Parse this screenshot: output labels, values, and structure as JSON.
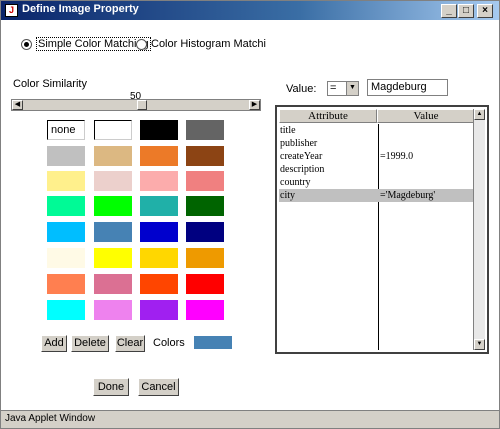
{
  "window": {
    "title": "Define Image Property",
    "controls": {
      "minimize": "_",
      "maximize": "□",
      "close": "×"
    }
  },
  "matching": {
    "options": [
      {
        "label": "Simple Color Matching",
        "selected": true
      },
      {
        "label": "Color Histogram Matchi",
        "selected": false
      }
    ]
  },
  "similarity": {
    "label": "Color Similarity",
    "value": "50"
  },
  "palette": {
    "first_swatch_text": "none",
    "swatches": [
      "none-box",
      "white-box",
      "#000000",
      "#646464",
      "#c0c0c0",
      "#dcb882",
      "#ec7a28",
      "#8c4414",
      "#fff08c",
      "#ecd0cc",
      "#fcacac",
      "#f08080",
      "#00fa96",
      "#00ff00",
      "#20b0a8",
      "#006400",
      "#00beff",
      "#4682b4",
      "#0000cd",
      "#000080",
      "#fffae6",
      "#ffff00",
      "#ffd700",
      "#ee9a00",
      "#ff7f50",
      "#db7093",
      "#ff4500",
      "#ff0000",
      "#00ffff",
      "#ee82ee",
      "#a020f0",
      "#ff00ff"
    ],
    "selected_color": "#4682b4"
  },
  "palette_buttons": {
    "add": "Add",
    "delete": "Delete",
    "clear": "Clear",
    "colors_label": "Colors"
  },
  "dialog_buttons": {
    "done": "Done",
    "cancel": "Cancel"
  },
  "value_filter": {
    "label": "Value:",
    "operator": "=",
    "text": "Magdeburg"
  },
  "attributes_table": {
    "headers": [
      "Attribute",
      "Value"
    ],
    "rows": [
      {
        "attribute": "title",
        "value": "",
        "selected": false
      },
      {
        "attribute": "publisher",
        "value": "",
        "selected": false
      },
      {
        "attribute": "createYear",
        "value": "=1999.0",
        "selected": false
      },
      {
        "attribute": "description",
        "value": "",
        "selected": false
      },
      {
        "attribute": "country",
        "value": "",
        "selected": false
      },
      {
        "attribute": "city",
        "value": "='Magdeburg'",
        "selected": true
      }
    ]
  },
  "status": {
    "text": "Java Applet Window"
  }
}
